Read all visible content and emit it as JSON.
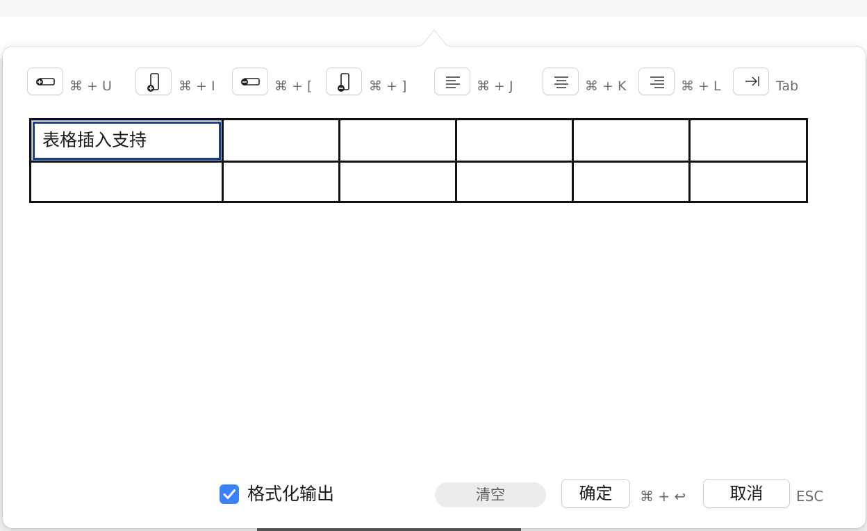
{
  "toolbar": {
    "items": [
      {
        "icon": "insert-row-icon",
        "shortcut": "⌘ + U"
      },
      {
        "icon": "insert-column-icon",
        "shortcut": "⌘ + I"
      },
      {
        "icon": "delete-row-icon",
        "shortcut": "⌘ + ["
      },
      {
        "icon": "delete-column-icon",
        "shortcut": "⌘ + ]"
      },
      {
        "icon": "align-left-icon",
        "shortcut": "⌘ + J"
      },
      {
        "icon": "align-center-icon",
        "shortcut": "⌘ + K"
      },
      {
        "icon": "align-right-icon",
        "shortcut": "⌘ + L"
      },
      {
        "icon": "next-cell-tab-icon",
        "shortcut": "Tab"
      }
    ]
  },
  "table": {
    "rows": [
      [
        "表格插入支持",
        "",
        "",
        "",
        "",
        ""
      ],
      [
        "",
        "",
        "",
        "",
        "",
        ""
      ]
    ],
    "active_cell": "row 1, column 1"
  },
  "footer": {
    "format_output": {
      "label": "格式化输出",
      "checked": true
    },
    "clear_label": "清空",
    "confirm_label": "确定",
    "confirm_shortcut": "⌘ + ↩",
    "cancel_label": "取消",
    "cancel_shortcut": "ESC"
  },
  "colors": {
    "checkbox": "#3b82f6",
    "active_cell_border": "#1f3c86",
    "table_border": "#111111"
  }
}
